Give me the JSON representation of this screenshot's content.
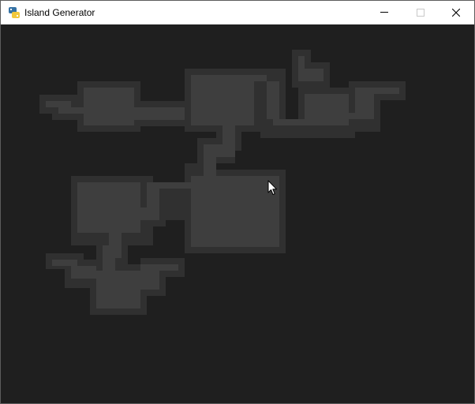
{
  "window": {
    "title": "Island Generator",
    "app_icon": "python-icon"
  },
  "caption_buttons": {
    "minimize": "minimize-icon",
    "maximize": "maximize-icon",
    "close": "close-icon"
  },
  "colors": {
    "background": "#1f1f1f",
    "outline": "#303030",
    "fill": "#3e3e3e"
  },
  "cursor": "arrow-pointer-icon"
}
